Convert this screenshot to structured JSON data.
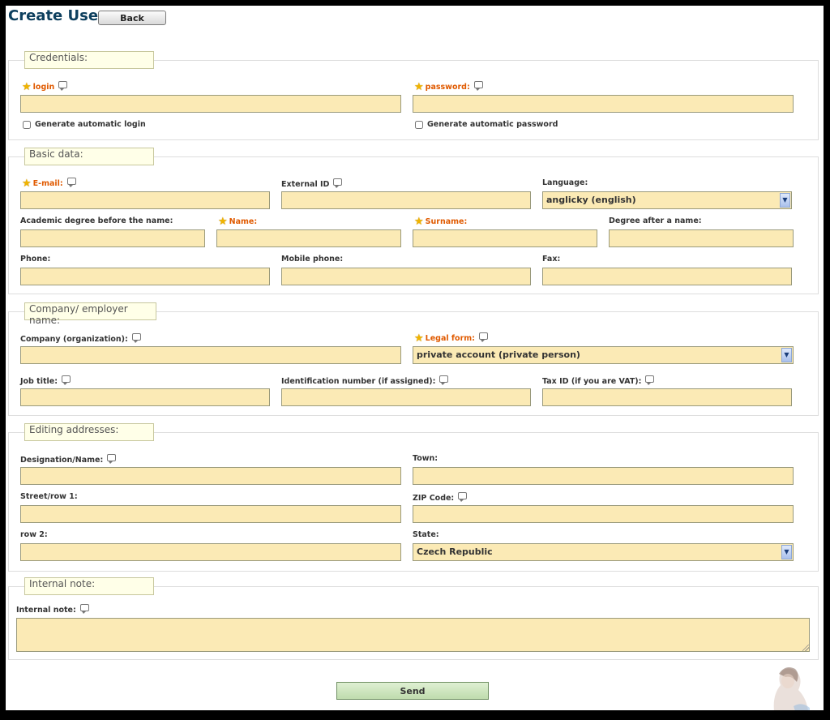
{
  "page": {
    "title": "Create User",
    "back_label": "Back",
    "send_label": "Send"
  },
  "credentials": {
    "legend": "Credentials:",
    "login_label": "login",
    "password_label": "password:",
    "gen_login": "Generate automatic login",
    "gen_password": "Generate automatic password"
  },
  "basic": {
    "legend": "Basic data:",
    "email": "E-mail:",
    "external_id": "External ID",
    "language": "Language:",
    "language_value": "anglicky (english)",
    "degree_before": "Academic degree before the name:",
    "name": "Name:",
    "surname": "Surname:",
    "degree_after": "Degree after a name:",
    "phone": "Phone:",
    "mobile": "Mobile phone:",
    "fax": "Fax:"
  },
  "company": {
    "legend": "Company/ employer name:",
    "company": "Company (organization):",
    "legal_form": "Legal form:",
    "legal_form_value": "private account (private person)",
    "job_title": "Job title:",
    "id_number": "Identification number (if assigned):",
    "tax_id": "Tax ID (if you are VAT):"
  },
  "addresses": {
    "legend": "Editing addresses:",
    "designation": "Designation/Name:",
    "town": "Town:",
    "street": "Street/row 1:",
    "zip": "ZIP Code:",
    "row2": "row 2:",
    "state": "State:",
    "state_value": "Czech Republic"
  },
  "note": {
    "legend": "Internal note:",
    "label": "Internal note:"
  },
  "icons": {
    "required": "star-icon",
    "help": "speech-bubble-icon",
    "dropdown": "chevron-down-icon"
  }
}
